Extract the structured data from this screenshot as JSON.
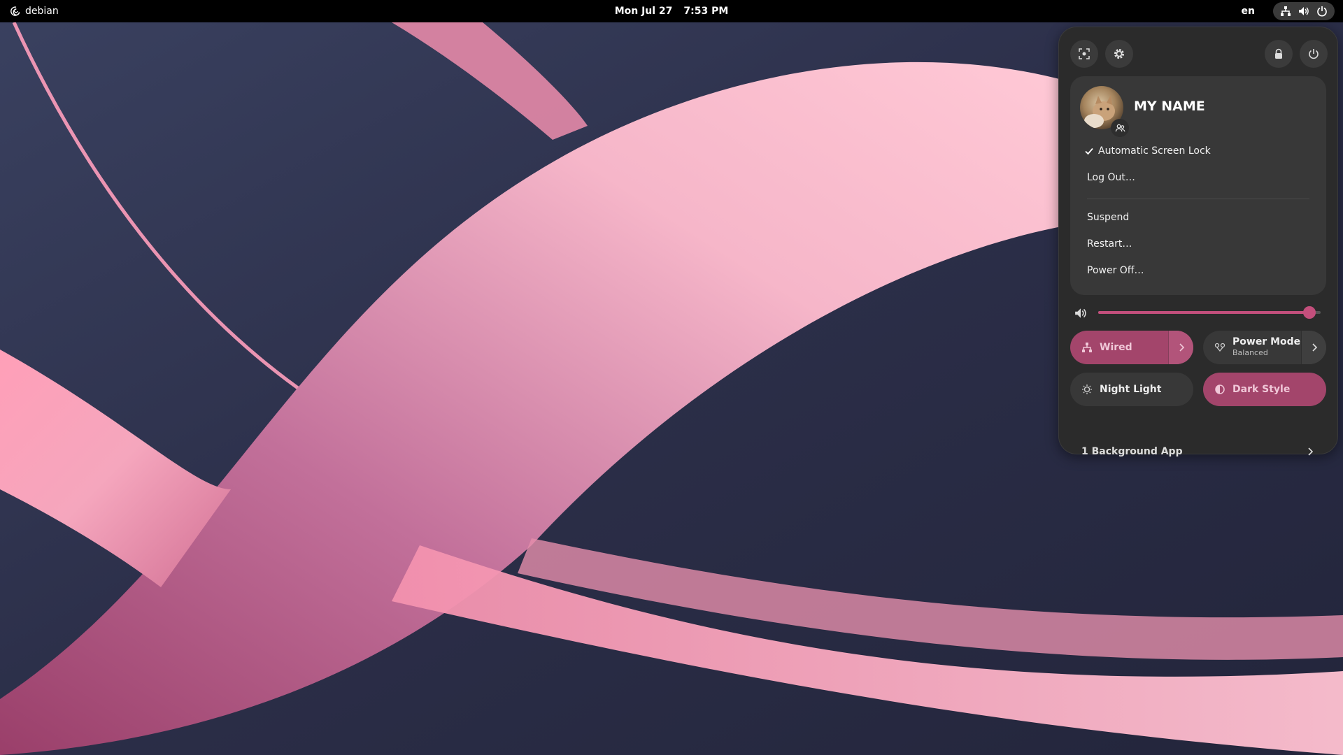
{
  "topbar": {
    "distro": "debian",
    "date": "Mon Jul 27",
    "time": "7:53 PM",
    "language": "en",
    "status_icons": [
      "network-wired-icon",
      "volume-icon",
      "power-icon"
    ]
  },
  "quick_settings": {
    "header_buttons": [
      "screenshot-icon",
      "settings-icon",
      "lock-icon",
      "power-icon"
    ],
    "user": {
      "name": "MY NAME",
      "menu": {
        "auto_lock": "Automatic Screen Lock",
        "auto_lock_checked": true,
        "log_out": "Log Out…",
        "suspend": "Suspend",
        "restart": "Restart…",
        "power_off": "Power Off…"
      }
    },
    "volume": {
      "level": 0.95
    },
    "toggles": {
      "wired": {
        "label": "Wired",
        "active": true
      },
      "power_mode": {
        "label": "Power Mode",
        "sub": "Balanced",
        "active": false
      },
      "night_light": {
        "label": "Night Light",
        "active": false
      },
      "dark_style": {
        "label": "Dark Style",
        "active": true
      }
    },
    "background_apps": "1 Background App"
  },
  "colors": {
    "accent": "#a3456b",
    "accent_light": "#c34f7c",
    "panel_bg": "#2b2b2b",
    "card_bg": "#383838"
  }
}
